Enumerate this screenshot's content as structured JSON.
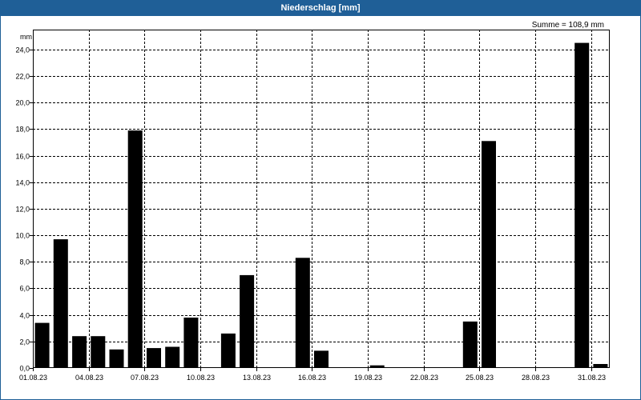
{
  "header": {
    "title": "Niederschlag [mm]"
  },
  "summary": {
    "text": "Summe = 108,9 mm"
  },
  "colors": {
    "titlebar": "#1f5f97",
    "bar": "#000000",
    "grid": "#000000",
    "background": "#ffffff"
  },
  "chart_data": {
    "type": "bar",
    "title": "Niederschlag [mm]",
    "ylabel": "mm",
    "xlabel": "",
    "ylim": [
      0,
      25.5
    ],
    "grid": true,
    "yticks": [
      0,
      2,
      4,
      6,
      8,
      10,
      12,
      14,
      16,
      18,
      20,
      22,
      24
    ],
    "ytick_labels": [
      "0,0",
      "2,0",
      "4,0",
      "6,0",
      "8,0",
      "10,0",
      "12,0",
      "14,0",
      "16,0",
      "18,0",
      "20,0",
      "22,0",
      "24,0"
    ],
    "xtick_labels": [
      "01.08.23",
      "04.08.23",
      "07.08.23",
      "10.08.23",
      "13.08.23",
      "16.08.23",
      "19.08.23",
      "22.08.23",
      "25.08.23",
      "28.08.23",
      "31.08.23"
    ],
    "categories": [
      "01.08.23",
      "02.08.23",
      "03.08.23",
      "04.08.23",
      "05.08.23",
      "06.08.23",
      "07.08.23",
      "08.08.23",
      "09.08.23",
      "10.08.23",
      "11.08.23",
      "12.08.23",
      "13.08.23",
      "14.08.23",
      "15.08.23",
      "16.08.23",
      "17.08.23",
      "18.08.23",
      "19.08.23",
      "20.08.23",
      "21.08.23",
      "22.08.23",
      "23.08.23",
      "24.08.23",
      "25.08.23",
      "26.08.23",
      "27.08.23",
      "28.08.23",
      "29.08.23",
      "30.08.23",
      "31.08.23"
    ],
    "values": [
      3.4,
      9.7,
      2.4,
      2.4,
      1.4,
      17.9,
      1.5,
      1.6,
      3.8,
      0,
      2.6,
      7.0,
      0,
      0,
      8.3,
      1.3,
      0,
      0,
      0.2,
      0,
      0,
      0,
      0,
      3.5,
      17.1,
      0,
      0,
      0,
      0,
      24.5,
      0.3
    ]
  }
}
